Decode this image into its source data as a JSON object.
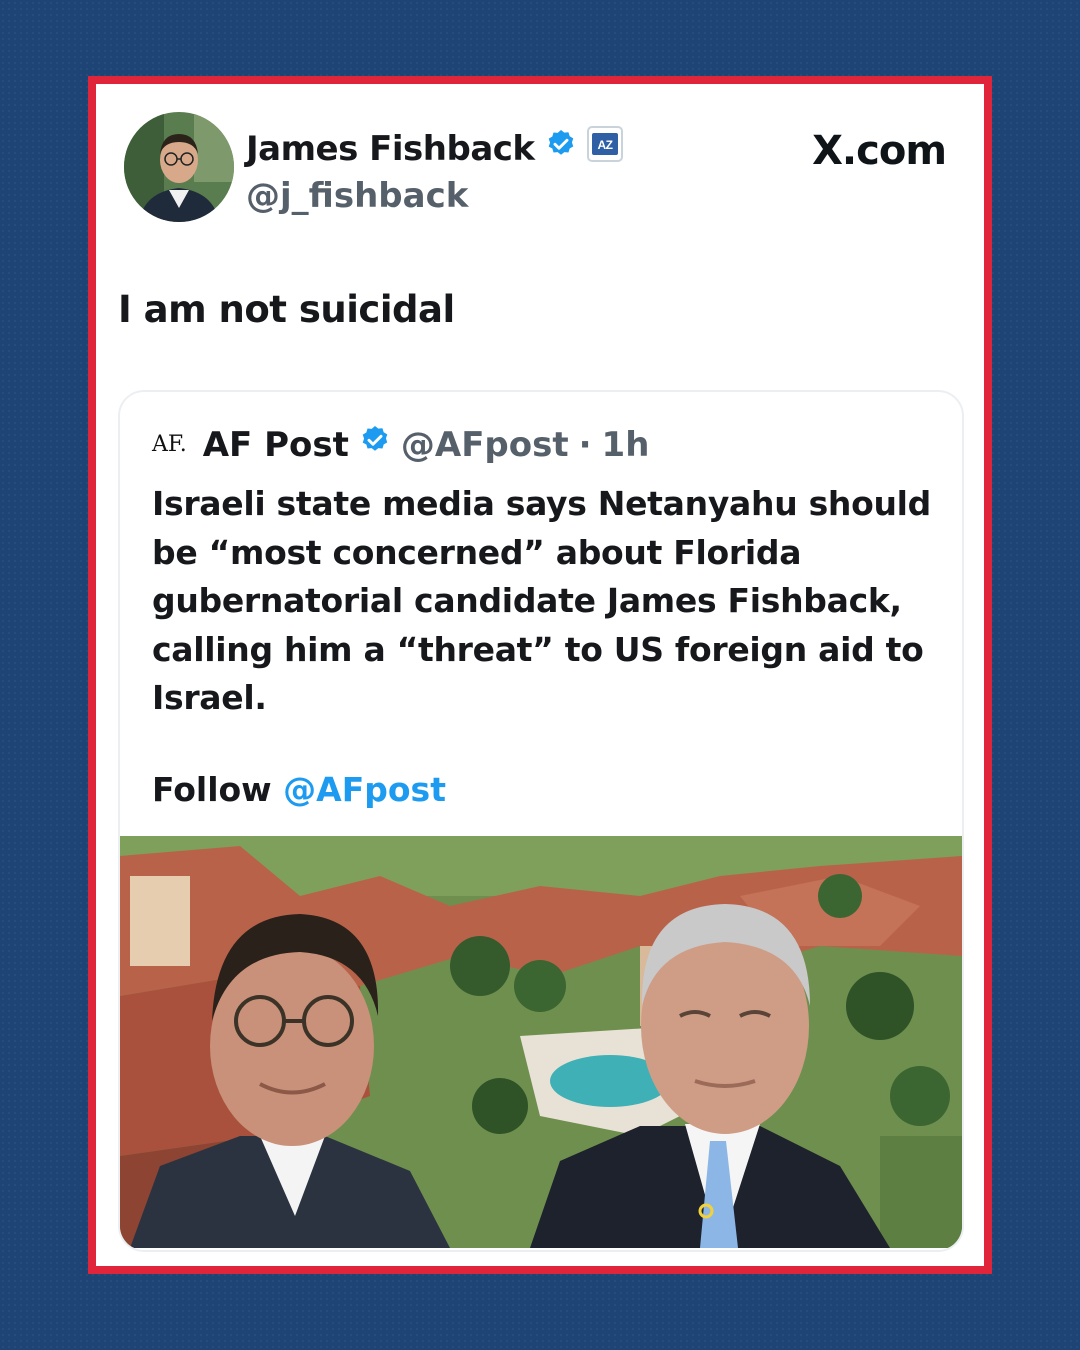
{
  "tweet": {
    "author_name": "James Fishback",
    "author_handle": "@j_fishback",
    "affiliate_badge": "AZ",
    "source_label": "X.com",
    "text": "I am not suicidal"
  },
  "quoted": {
    "logo_text": "AF.",
    "author_name": "AF Post",
    "author_handle": "@AFpost",
    "separator": "·",
    "time": "1h",
    "body": "Israeli state media says Netanyahu should be “most concerned” about Florida gubernatorial candidate James Fishback, calling him a “threat” to US foreign aid to Israel.",
    "follow_prefix": "Follow",
    "follow_link": "@AFpost"
  },
  "colors": {
    "frame": "#e0253a",
    "background": "#1d4475",
    "verified": "#1d9bf0",
    "link": "#1d9bf0"
  },
  "icons": {
    "verified": "verified-badge-icon",
    "affiliate": "affiliate-badge-icon"
  }
}
